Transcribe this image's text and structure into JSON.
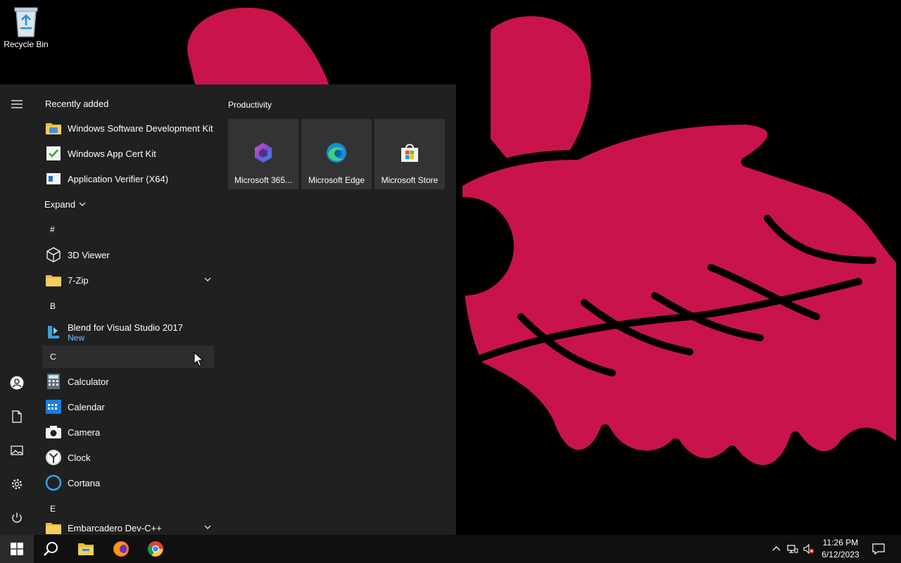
{
  "desktop": {
    "recycle_bin_label": "Recycle Bin"
  },
  "start_menu": {
    "recently_added_title": "Recently added",
    "recent": [
      {
        "label": "Windows Software Development Kit",
        "icon": "folder-icon"
      },
      {
        "label": "Windows App Cert Kit",
        "icon": "cert-kit-icon"
      },
      {
        "label": "Application Verifier (X64)",
        "icon": "app-verifier-icon"
      }
    ],
    "expand_label": "Expand",
    "letters": {
      "hash": "#",
      "b": "B",
      "c": "C",
      "e": "E"
    },
    "apps": {
      "viewer3d": "3D Viewer",
      "zip": "7-Zip",
      "blend": "Blend for Visual Studio 2017",
      "blend_badge": "New",
      "calculator": "Calculator",
      "calendar": "Calendar",
      "camera": "Camera",
      "clock": "Clock",
      "cortana": "Cortana",
      "embarcadero": "Embarcadero Dev-C++"
    },
    "tiles_group": "Productivity",
    "tiles": [
      {
        "label": "Microsoft 365...",
        "icon": "microsoft-365-icon"
      },
      {
        "label": "Microsoft Edge",
        "icon": "edge-icon"
      },
      {
        "label": "Microsoft Store",
        "icon": "store-icon"
      }
    ]
  },
  "taskbar": {
    "time": "11:26 PM",
    "date": "6/12/2023"
  },
  "colors": {
    "wallpaper_pink": "#c8144a",
    "menu_bg": "#202020",
    "tile_bg": "#333333",
    "accent_blue": "#7fbfff"
  }
}
